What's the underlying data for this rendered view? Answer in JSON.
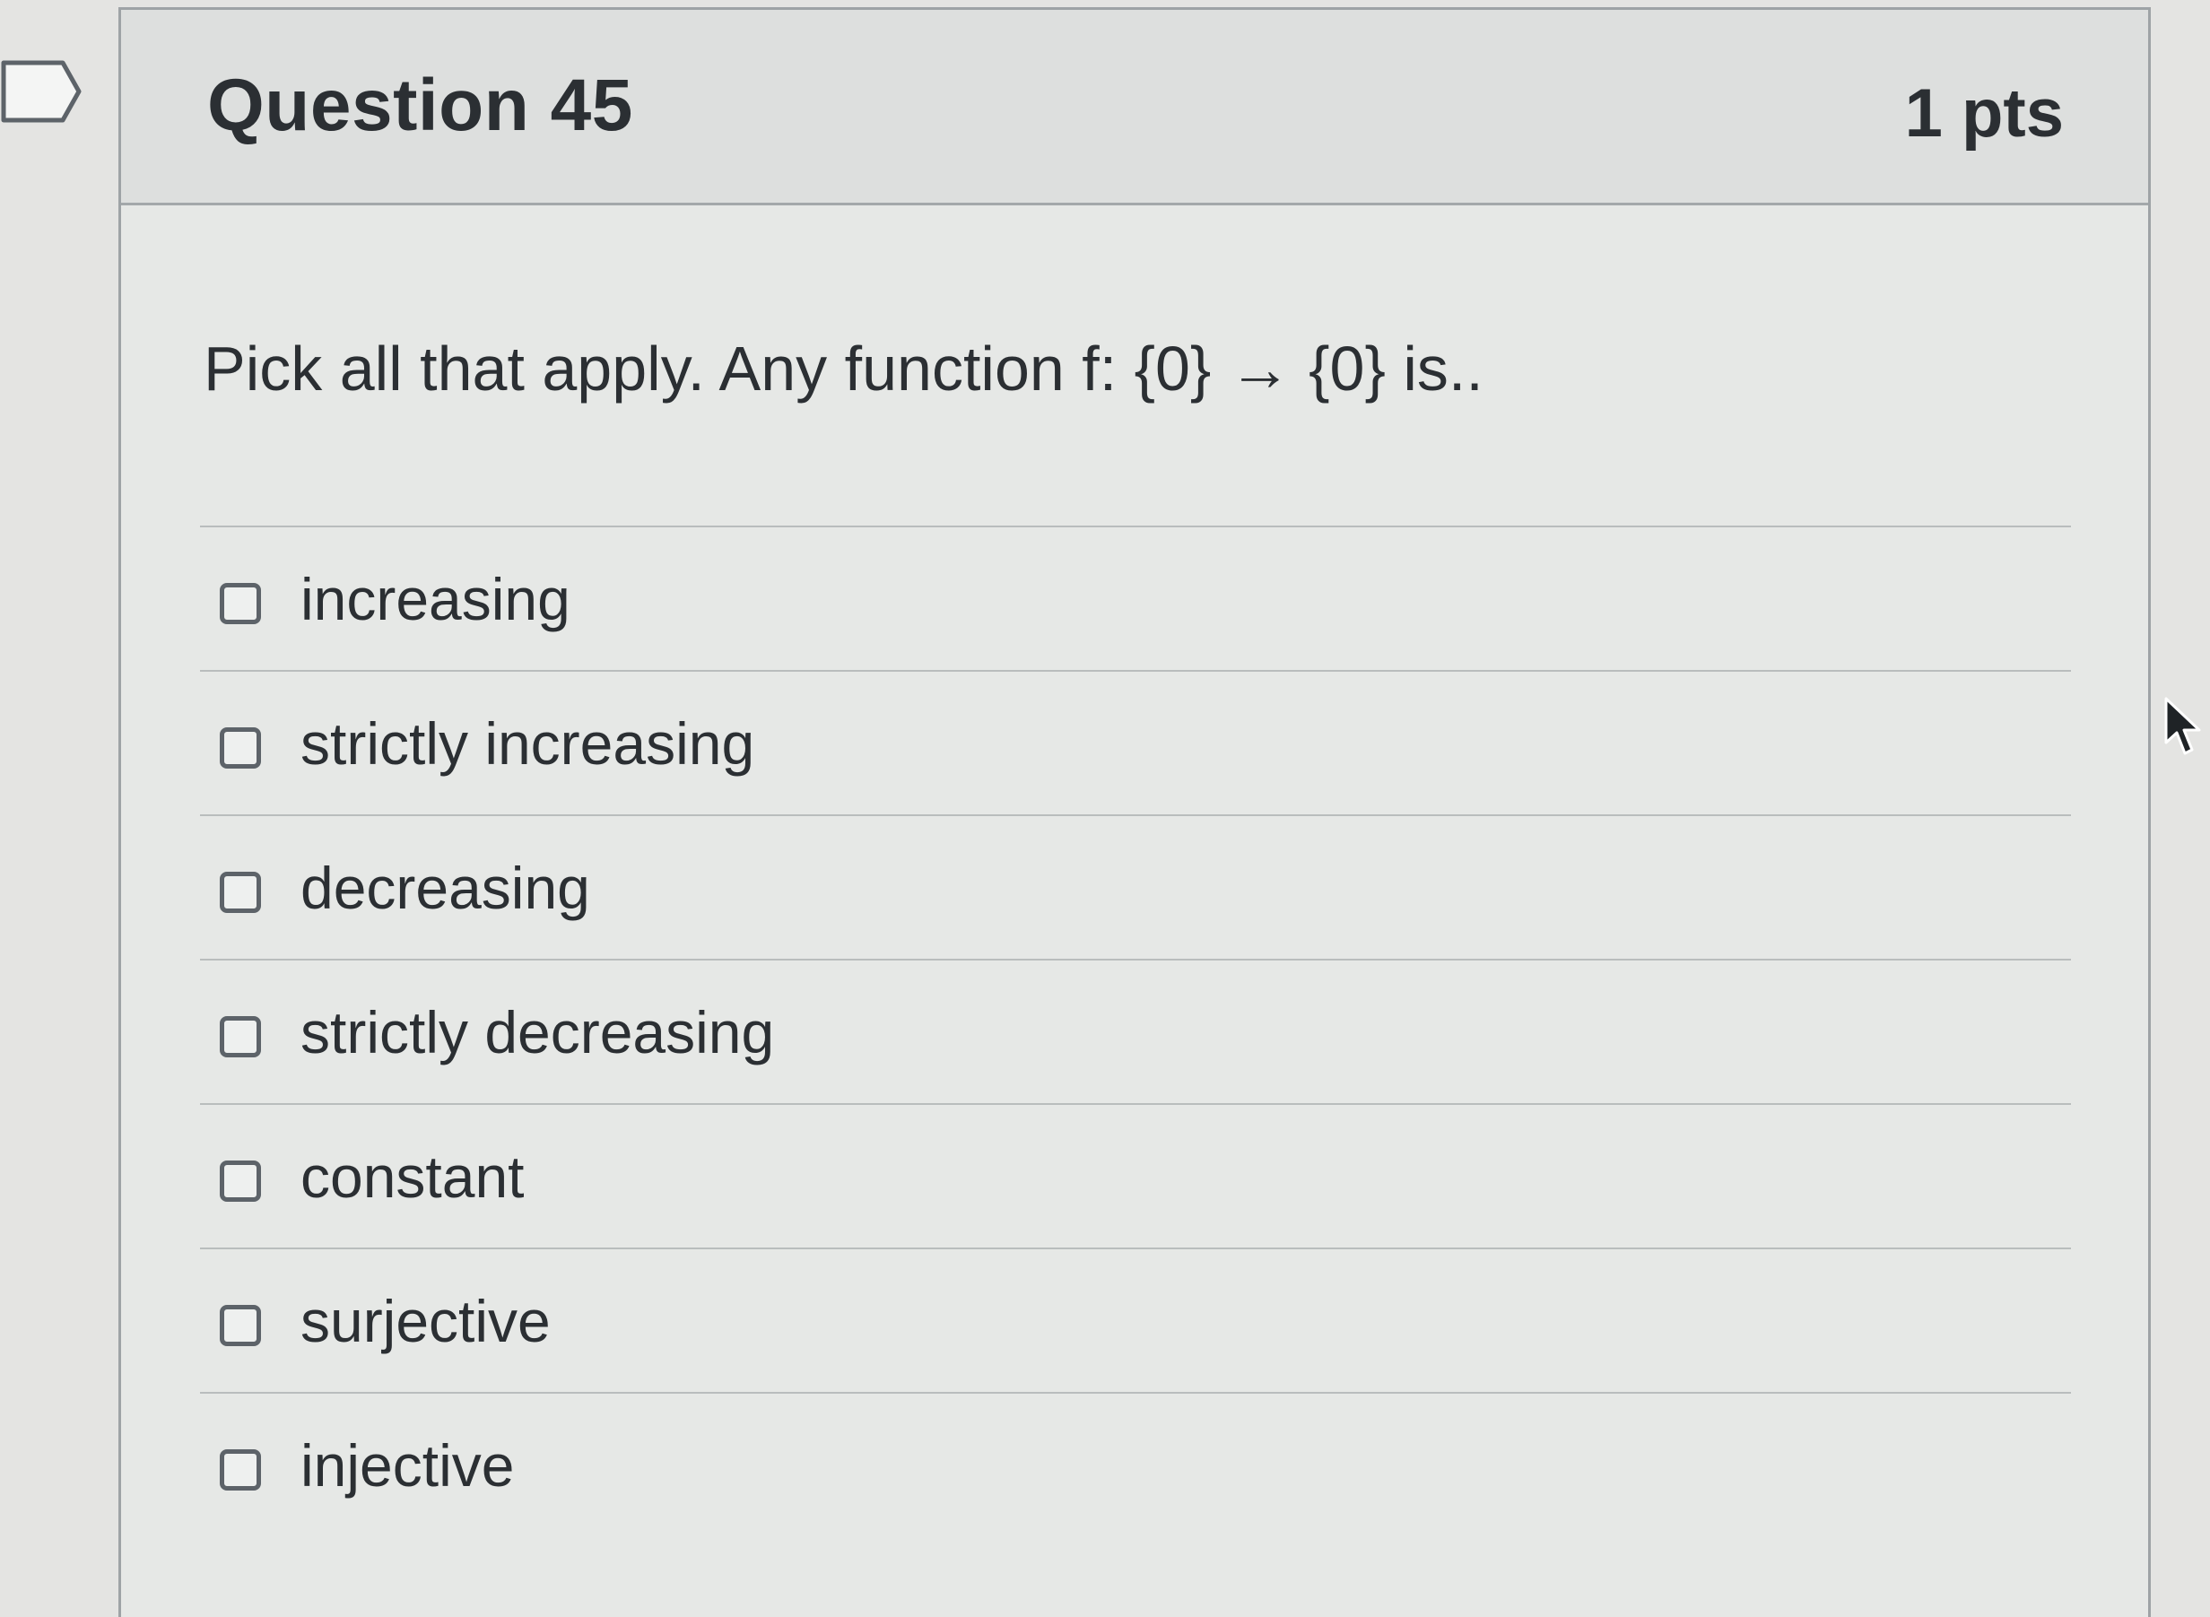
{
  "question": {
    "title": "Question 45",
    "points": "1 pts",
    "text": "Pick all that apply. Any function f: {0} → {0} is..",
    "answers": [
      {
        "label": "increasing",
        "checked": false
      },
      {
        "label": "strictly increasing",
        "checked": false
      },
      {
        "label": "decreasing",
        "checked": false
      },
      {
        "label": "strictly decreasing",
        "checked": false
      },
      {
        "label": "constant",
        "checked": false
      },
      {
        "label": "surjective",
        "checked": false
      },
      {
        "label": "injective",
        "checked": false
      }
    ]
  },
  "icons": {
    "flag": "flag-question-icon",
    "cursor": "mouse-pointer-icon"
  },
  "colors": {
    "text": "#2b2f33",
    "border": "#9ea3a6",
    "checkbox": "#5d6369"
  }
}
